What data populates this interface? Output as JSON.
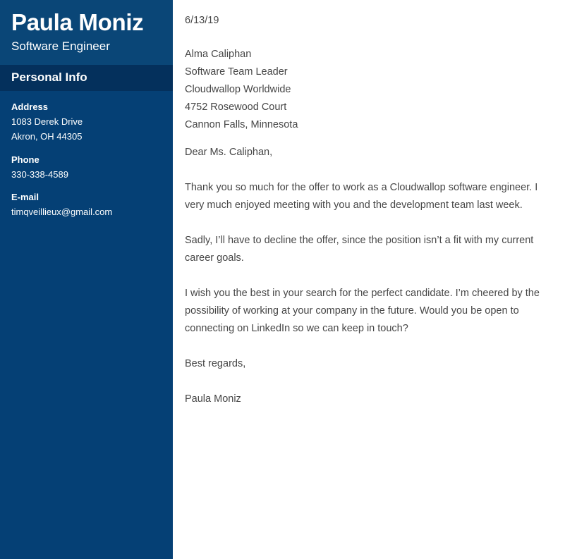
{
  "sidebar": {
    "name": "Paula Moniz",
    "job_title": "Software Engineer",
    "section_title": "Personal Info",
    "info": [
      {
        "label": "Address",
        "lines": [
          "1083 Derek Drive",
          "Akron, OH 44305"
        ]
      },
      {
        "label": "Phone",
        "lines": [
          "330-338-4589"
        ]
      },
      {
        "label": "E-mail",
        "lines": [
          "timqveillieux@gmail.com"
        ]
      }
    ],
    "colors": {
      "header_background": "#0a4677",
      "section_bar_background": "#04305c",
      "body_background": "#054075",
      "text": "#ffffff"
    }
  },
  "letter": {
    "date": "6/13/19",
    "recipient": [
      "Alma Caliphan",
      "Software Team Leader",
      "Cloudwallop Worldwide",
      "4752 Rosewood Court",
      "Cannon Falls, Minnesota"
    ],
    "salutation": "Dear Ms. Caliphan,",
    "paragraphs": [
      "Thank you so much for the offer to work as a Cloudwallop software engineer. I very much enjoyed meeting with you and the development team last week.",
      "Sadly, I’ll have to decline the offer, since the position isn’t a fit with my current career goals.",
      "I wish you the best in your search for the perfect candidate. I’m cheered by the possibility of working at your company in the future. Would you be open to connecting on LinkedIn so we can keep in touch?"
    ],
    "closing": "Best regards,",
    "signature": "Paula Moniz",
    "colors": {
      "text": "#464646",
      "background": "#ffffff"
    }
  }
}
